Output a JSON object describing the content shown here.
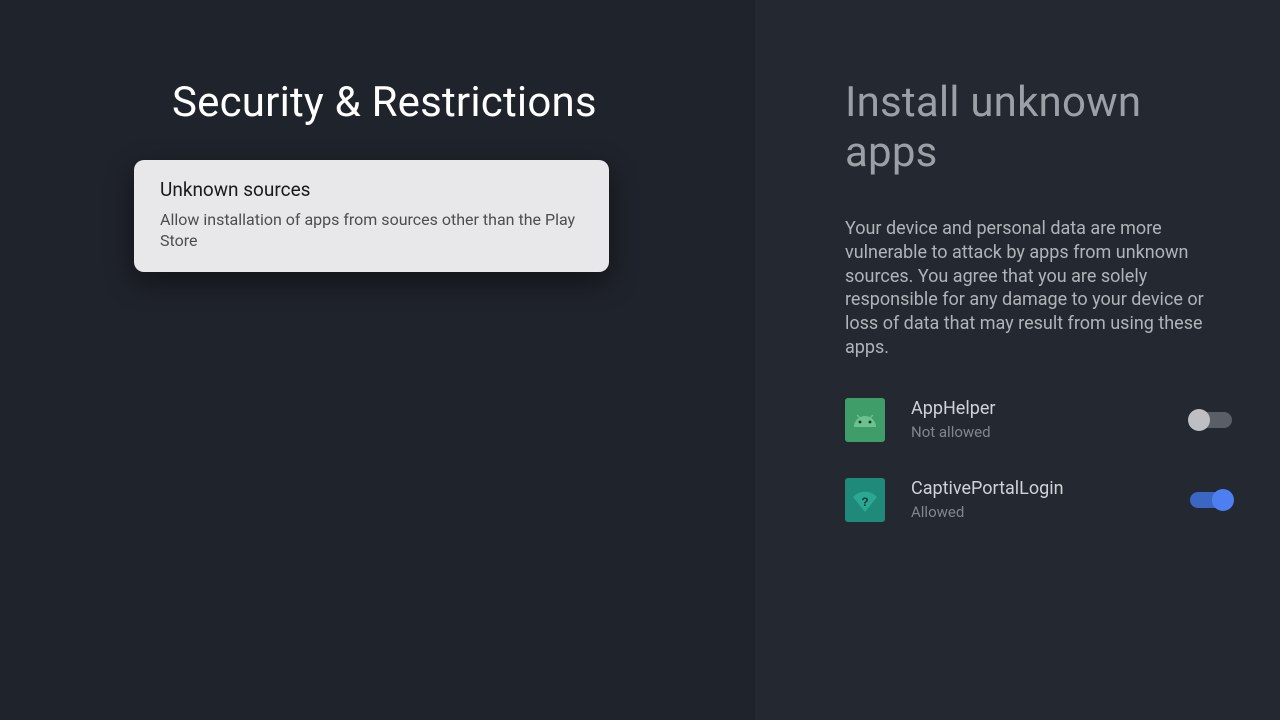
{
  "left": {
    "title": "Security & Restrictions",
    "card": {
      "title": "Unknown sources",
      "subtitle": "Allow installation of apps from sources other than the Play Store"
    }
  },
  "right": {
    "title": "Install unknown apps",
    "description": "Your device and personal data are more vulnerable to attack by apps from unknown sources. You agree that you are solely responsible for any damage to your device or loss of data that may result from using these apps.",
    "apps": [
      {
        "name": "AppHelper",
        "status": "Not allowed",
        "allowed": false,
        "icon": "android"
      },
      {
        "name": "CaptivePortalLogin",
        "status": "Allowed",
        "allowed": true,
        "icon": "wifi-question"
      }
    ]
  }
}
